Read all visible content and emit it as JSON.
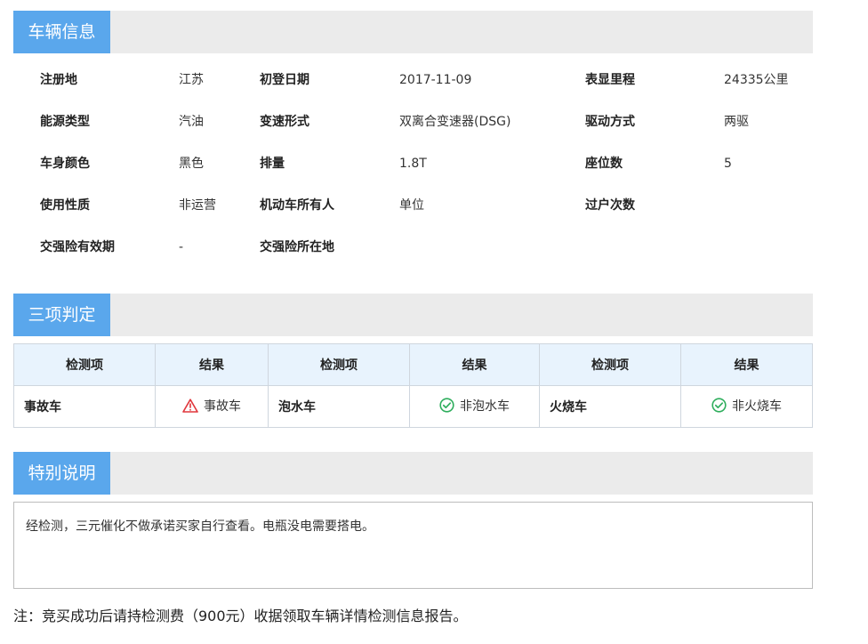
{
  "sections": {
    "vehicle_info": "车辆信息",
    "three_judgments": "三项判定",
    "special_notes": "特别说明"
  },
  "vehicle_info": {
    "rows": [
      [
        {
          "label": "注册地",
          "value": "江苏"
        },
        {
          "label": "初登日期",
          "value": "2017-11-09"
        },
        {
          "label": "表显里程",
          "value": "24335公里"
        }
      ],
      [
        {
          "label": "能源类型",
          "value": "汽油"
        },
        {
          "label": "变速形式",
          "value": "双离合变速器(DSG)"
        },
        {
          "label": "驱动方式",
          "value": "两驱"
        }
      ],
      [
        {
          "label": "车身颜色",
          "value": "黑色"
        },
        {
          "label": "排量",
          "value": "1.8T"
        },
        {
          "label": "座位数",
          "value": "5"
        }
      ],
      [
        {
          "label": "使用性质",
          "value": "非运营"
        },
        {
          "label": "机动车所有人",
          "value": "单位"
        },
        {
          "label": "过户次数",
          "value": ""
        }
      ],
      [
        {
          "label": "交强险有效期",
          "value": "-"
        },
        {
          "label": "交强险所在地",
          "value": ""
        }
      ]
    ]
  },
  "judgment_table": {
    "headers": [
      "检测项",
      "结果",
      "检测项",
      "结果",
      "检测项",
      "结果"
    ],
    "items": [
      {
        "item": "事故车",
        "result": "事故车",
        "status": "warning",
        "icon": "warning-triangle-icon",
        "color": "#e0363c"
      },
      {
        "item": "泡水车",
        "result": "非泡水车",
        "status": "ok",
        "icon": "check-circle-icon",
        "color": "#2fae5d"
      },
      {
        "item": "火烧车",
        "result": "非火烧车",
        "status": "ok",
        "icon": "check-circle-icon",
        "color": "#2fae5d"
      }
    ]
  },
  "special_note": "经检测，三元催化不做承诺买家自行查看。电瓶没电需要搭电。",
  "footnote": "注：竞买成功后请持检测费（900元）收据领取车辆详情检测信息报告。",
  "colors": {
    "accent": "#5aa7ec",
    "header_bg": "#ebebeb",
    "table_header_bg": "#e8f3fd",
    "warning": "#e0363c",
    "ok": "#2fae5d"
  }
}
